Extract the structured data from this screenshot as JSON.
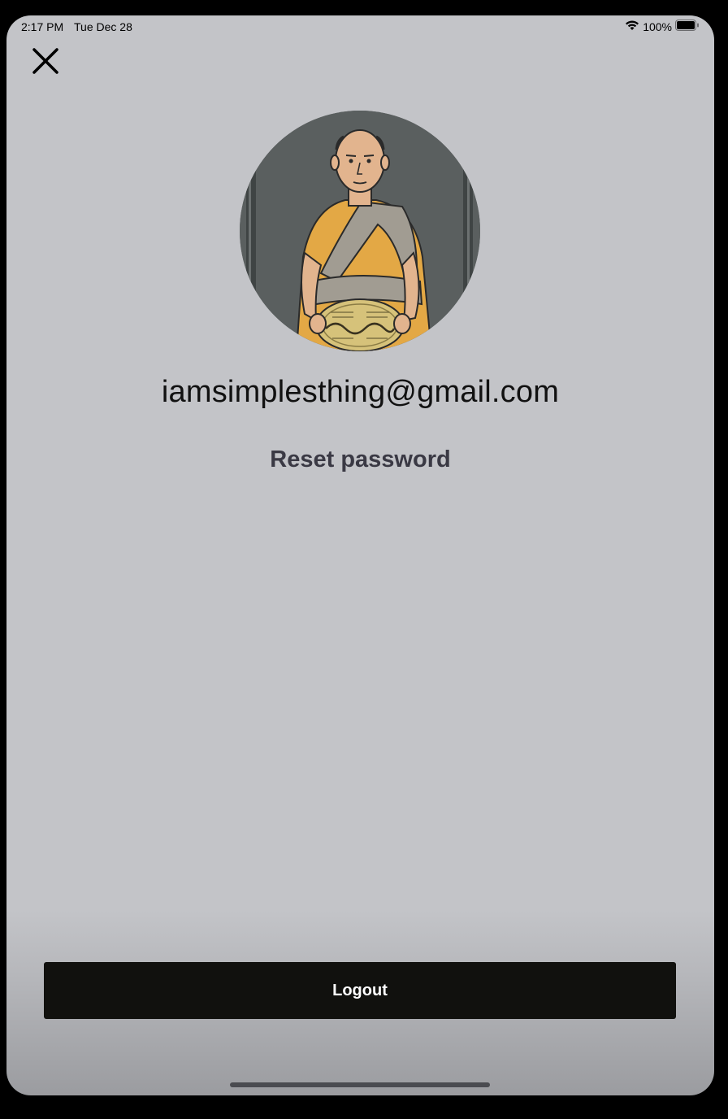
{
  "status_bar": {
    "time": "2:17 PM",
    "date": "Tue Dec 28",
    "battery": "100%",
    "wifi_icon": "wifi-icon",
    "battery_icon": "battery-icon"
  },
  "header": {
    "close_icon": "close-icon"
  },
  "profile": {
    "avatar_alt": "avatar",
    "email": "iamsimplesthing@gmail.com",
    "reset_password_label": "Reset password"
  },
  "footer": {
    "logout_label": "Logout"
  },
  "colors": {
    "background": "#c3c4c8",
    "logout_button": "#11110e",
    "logout_text": "#ffffff",
    "reset_text": "#3a3944"
  }
}
